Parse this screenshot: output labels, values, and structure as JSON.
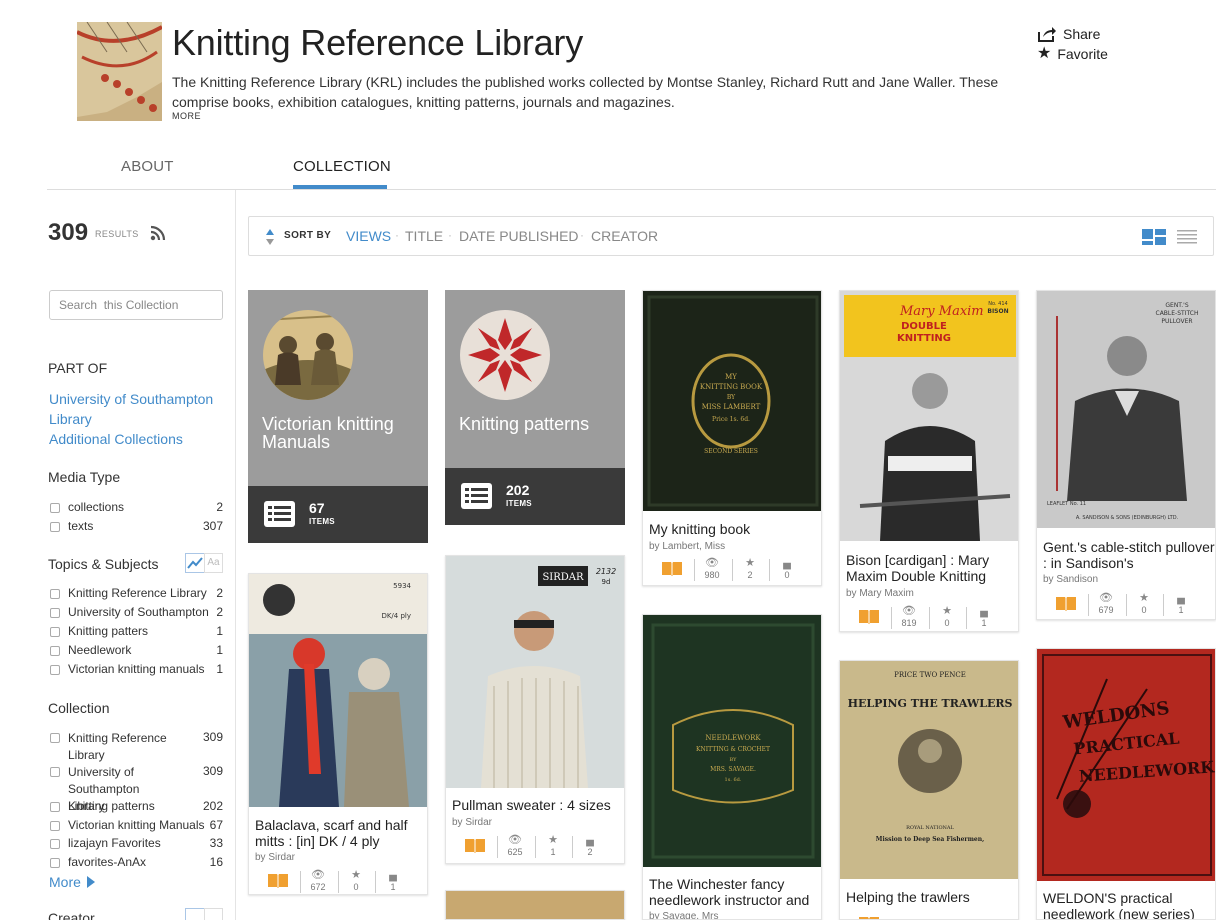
{
  "header": {
    "title": "Knitting Reference Library",
    "description": "The Knitting Reference Library (KRL) includes the published works collected by Montse Stanley, Richard Rutt and Jane Waller. These comprise books, exhibition catalogues, knitting patterns, journals and magazines.",
    "more_label": "MORE",
    "share_label": "Share",
    "favorite_label": "Favorite"
  },
  "tabs": [
    {
      "label": "ABOUT"
    },
    {
      "label": "COLLECTION",
      "active": true
    }
  ],
  "sidebar": {
    "results_count": "309",
    "results_label": "RESULTS",
    "search_placeholder": "Search  this Collection",
    "part_of_heading": "PART OF",
    "part_of_links": [
      "University of Southampton",
      "Library",
      "Additional Collections"
    ],
    "media_type": {
      "heading": "Media Type",
      "items": [
        {
          "label": "collections",
          "count": "2"
        },
        {
          "label": "texts",
          "count": "307"
        }
      ]
    },
    "topics": {
      "heading": "Topics & Subjects",
      "toggle_label": "Aa",
      "items": [
        {
          "label": "Knitting Reference Library",
          "count": "2"
        },
        {
          "label": "University of Southampton",
          "count": "2"
        },
        {
          "label": "Knitting patters",
          "count": "1"
        },
        {
          "label": "Needlework",
          "count": "1"
        },
        {
          "label": "Victorian knitting manuals",
          "count": "1"
        }
      ]
    },
    "collection": {
      "heading": "Collection",
      "items": [
        {
          "label": "Knitting Reference Library",
          "count": "309"
        },
        {
          "label": "University of Southampton Library",
          "count": "309"
        },
        {
          "label": "Knitting patterns",
          "count": "202"
        },
        {
          "label": "Victorian knitting Manuals",
          "count": "67"
        },
        {
          "label": "lizajayn Favorites",
          "count": "33"
        },
        {
          "label": "favorites-AnAx",
          "count": "16"
        }
      ]
    },
    "more_label": "More",
    "creator_heading": "Creator"
  },
  "sort": {
    "label": "SORT BY",
    "options": [
      "VIEWS",
      "TITLE",
      "DATE PUBLISHED",
      "CREATOR"
    ],
    "active": "VIEWS"
  },
  "collection_tiles": [
    {
      "title": "Victorian knitting Manuals",
      "count": "67",
      "items_label": "ITEMS"
    },
    {
      "title": "Knitting patterns",
      "count": "202",
      "items_label": "ITEMS"
    }
  ],
  "items": [
    {
      "title": "My knitting book",
      "by": "by Lambert, Miss",
      "views": "980",
      "favs": "2",
      "reviews": "0",
      "cover_text": [
        "MY",
        "KNITTING BOOK",
        "BY",
        "MISS LAMBERT",
        "Price 1s. 6d.",
        "SECOND SERIES"
      ]
    },
    {
      "title": "Bison [cardigan] : Mary Maxim Double Knitting",
      "by": "by Mary Maxim",
      "views": "819",
      "favs": "0",
      "reviews": "1",
      "cover_text": [
        "Mary Maxim",
        "DOUBLE",
        "KNITTING",
        "No. 414",
        "BISON"
      ]
    },
    {
      "title": "Gent.'s cable-stitch pullover : in Sandison's",
      "by": "by Sandison",
      "views": "679",
      "favs": "0",
      "reviews": "1",
      "cover_text": [
        "GENT.'S",
        "CABLE-STITCH",
        "PULLOVER",
        "LEAFLET No. 11",
        "A. SANDISON & SONS (EDINBURGH) LTD."
      ]
    },
    {
      "title": "Balaclava, scarf and half mitts : [in] DK / 4 ply",
      "by": "by Sirdar",
      "views": "672",
      "favs": "0",
      "reviews": "1",
      "cover_text": [
        "5934",
        "DK/4 ply"
      ]
    },
    {
      "title": "Pullman sweater : 4 sizes",
      "by": "by Sirdar",
      "views": "625",
      "favs": "1",
      "reviews": "2",
      "cover_text": [
        "SIRDAR",
        "2132",
        "9d"
      ]
    },
    {
      "title": "The Winchester fancy needlework instructor and",
      "by": "by Savage, Mrs",
      "cover_text": [
        "NEEDLEWORK",
        "KNITTING & CROCHET",
        "BY",
        "MRS. SAVAGE.",
        "1s. 6d."
      ]
    },
    {
      "title": "Helping the trawlers",
      "by": "",
      "cover_text": [
        "PRICE TWO PENCE",
        "HELPING THE TRAWLERS",
        "ROYAL NATIONAL",
        "Mission to Deep Sea Fishermen,"
      ]
    },
    {
      "title": "WELDON'S practical needlework (new series)",
      "by": "",
      "cover_text": [
        "WELDONS",
        "PRACTICAL",
        "NEEDLEWORK"
      ]
    }
  ],
  "colors": {
    "accent": "#428bca",
    "collection_tile_bg": "#9c9c9c",
    "collection_tile_bar": "#3a3a3a",
    "book_icon": "#f0a030"
  }
}
